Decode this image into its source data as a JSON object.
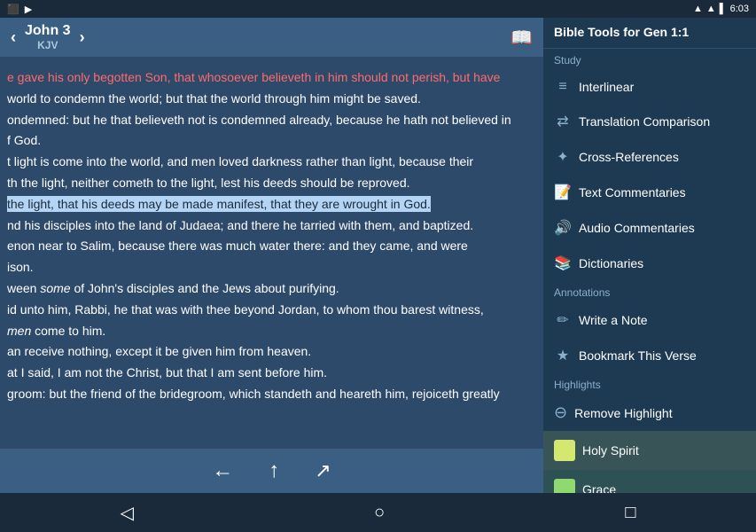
{
  "statusBar": {
    "leftIcons": [
      "⬛",
      "▶"
    ],
    "rightText": "6:03",
    "signalIcon": "▲",
    "batteryIcon": "🔋"
  },
  "bibleHeader": {
    "bookTitle": "John 3",
    "version": "KJV",
    "prevArrow": "‹",
    "nextArrow": "›",
    "menuIcon": "📖"
  },
  "bibleText": [
    "e gave his only begotten Son, that whosoever believeth in him should not perish, but have",
    "",
    "world to condemn the world; but that the world through him might be saved.",
    "",
    "ondemned: but he that believeth not is condemned already, because he hath not believed in",
    "f God.",
    "",
    "t light is come into the world, and men loved darkness rather than light, because their",
    "",
    "th the light, neither cometh to the light, lest his deeds should be reproved.",
    "",
    "the light, that his deeds may be made manifest, that they are wrought in God.",
    "",
    "nd his disciples into the land of Judaea; and there he tarried with them, and baptized.",
    "",
    "enon near to Salim, because there was much water there: and they came, and were",
    "",
    "ison.",
    "",
    "ween some of John's disciples and the Jews about purifying.",
    "",
    "id unto him, Rabbi, he that was with thee beyond Jordan, to whom thou barest witness,",
    "men come to him.",
    "",
    "an receive nothing, except it be given him from heaven.",
    "",
    "at I said, I am not the Christ, but that I am sent before him.",
    "",
    "groom: but the friend of the bridegroom, which standeth and heareth him, rejoiceth greatly"
  ],
  "bibleToolbar": {
    "backBtn": "←",
    "upBtn": "↑",
    "shareBtn": "↗"
  },
  "sidebar": {
    "headerTitle": "Bible Tools for Gen 1:1",
    "studyLabel": "Study",
    "studyItems": [
      {
        "label": "Interlinear",
        "icon": ""
      },
      {
        "label": "Translation Comparison",
        "icon": ""
      },
      {
        "label": "Cross-References",
        "icon": ""
      },
      {
        "label": "Text Commentaries",
        "icon": ""
      },
      {
        "label": "Audio Commentaries",
        "icon": ""
      },
      {
        "label": "Dictionaries",
        "icon": ""
      }
    ],
    "annotationsLabel": "Annotations",
    "annotationItems": [
      {
        "label": "Write a Note",
        "icon": "✏"
      },
      {
        "label": "Bookmark This Verse",
        "icon": "★"
      }
    ],
    "highlightsLabel": "Highlights",
    "removeHighlight": {
      "label": "Remove Highlight",
      "icon": "⊖"
    },
    "highlightColors": [
      {
        "label": "Holy Spirit",
        "color": "#d4e870"
      },
      {
        "label": "Grace",
        "color": "#90d870"
      }
    ]
  },
  "androidNav": {
    "backBtn": "◁",
    "homeBtn": "○",
    "recentBtn": "□"
  }
}
